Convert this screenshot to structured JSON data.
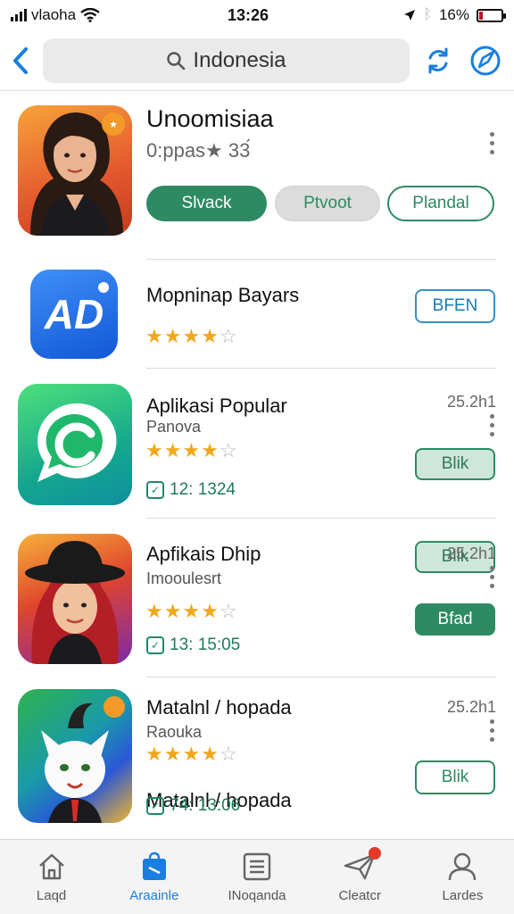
{
  "status_bar": {
    "carrier": "vlaoha",
    "time": "13:26",
    "battery_percent": "16%",
    "battery_level": 0.16
  },
  "top_bar": {
    "search_text": "Indonesia"
  },
  "featured": {
    "title": "Unoomisiaa",
    "rating_text": "0:ppas★ 33́",
    "badge_icon": "badge-icon",
    "buttons": [
      {
        "label": "Slvack"
      },
      {
        "label": "Ptvoot"
      },
      {
        "label": "Plandal"
      }
    ]
  },
  "apps": [
    {
      "title": "Mopninap Bayars",
      "subtitle": "",
      "rating": 4,
      "size": "",
      "meta": "",
      "button": "BFEN"
    },
    {
      "title": "Aplikasi Popular",
      "subtitle": "Panova",
      "rating": 4,
      "size": "25.2h1",
      "meta": "12: 1324",
      "button": "Blik"
    },
    {
      "title": "Apfikais Dhip",
      "subtitle": "Imooulesrt",
      "rating": 4,
      "size": "25.2h1",
      "meta": "13: 15:05",
      "button": "Bfad"
    },
    {
      "title": "Matalnl / hopada",
      "subtitle": "Raouka",
      "rating": 4,
      "size": "25.2h1",
      "meta": "74: 13:06",
      "button": "Blik"
    }
  ],
  "bottom_nav": [
    {
      "label": "Laqd",
      "icon": "home-icon"
    },
    {
      "label": "Araainle",
      "icon": "bag-icon"
    },
    {
      "label": "INoqanda",
      "icon": "list-icon"
    },
    {
      "label": "Cleatcr",
      "icon": "send-icon"
    },
    {
      "label": "Lardes",
      "icon": "person-icon"
    }
  ],
  "colors": {
    "accent_green": "#2e8a63",
    "accent_blue": "#1a7ee0",
    "star": "#f2a71b"
  }
}
